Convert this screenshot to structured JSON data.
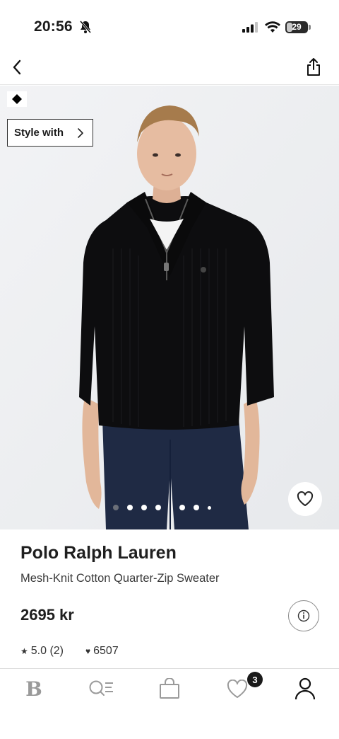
{
  "status_bar": {
    "time": "20:56",
    "battery": "29",
    "battery_level": 0.29
  },
  "nav": {
    "back_icon": "chevron-left-icon",
    "share_icon": "share-icon"
  },
  "gallery": {
    "style_with_label": "Style with",
    "image_count": 8,
    "active_image_index": 1,
    "favorite_icon": "heart-outline-icon"
  },
  "product": {
    "brand": "Polo Ralph Lauren",
    "name": "Mesh-Knit Cotton Quarter-Zip Sweater",
    "price": "2695 kr",
    "rating": "5.0 (2)",
    "likes": "6507"
  },
  "tab_bar": {
    "home_label": "B",
    "wishlist_badge": "3",
    "icons": [
      "home-logo-icon",
      "search-icon",
      "bag-icon",
      "heart-icon",
      "profile-icon"
    ]
  }
}
